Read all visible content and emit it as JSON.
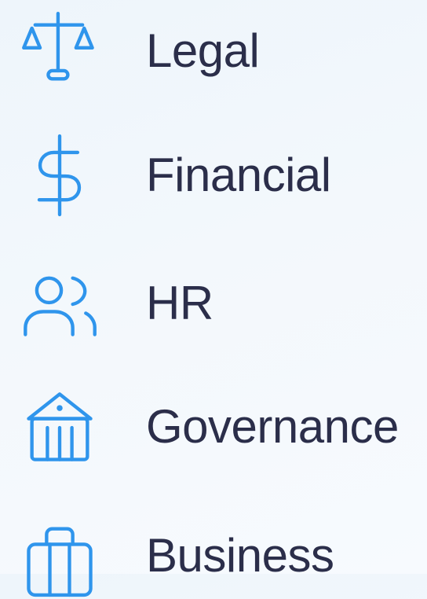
{
  "menu": {
    "items": [
      {
        "label": "Legal",
        "icon": "scale-icon"
      },
      {
        "label": "Financial",
        "icon": "dollar-icon"
      },
      {
        "label": "HR",
        "icon": "users-icon"
      },
      {
        "label": "Governance",
        "icon": "bank-icon"
      },
      {
        "label": "Business",
        "icon": "briefcase-icon"
      }
    ],
    "accent_color": "#2f95ec",
    "text_color": "#2b2e4a"
  }
}
